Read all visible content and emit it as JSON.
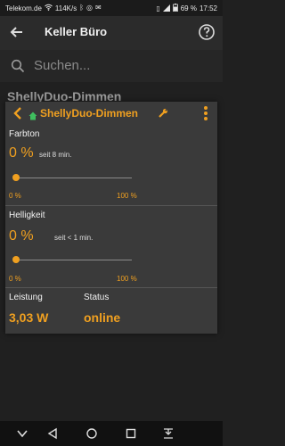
{
  "status": {
    "carrier": "Telekom.de",
    "speed": "114K/s",
    "battery": "69 %",
    "time": "17:52"
  },
  "header": {
    "title": "Keller Büro"
  },
  "search": {
    "placeholder": "Suchen..."
  },
  "background_list": {
    "first_item": "ShellyDuo-Dimmen"
  },
  "dialog": {
    "title": "ShellyDuo-Dimmen",
    "farbton": {
      "label": "Farbton",
      "value": "0 %",
      "since": "seit 8 min.",
      "min": "0 %",
      "max": "100 %",
      "level": 0
    },
    "helligkeit": {
      "label": "Helligkeit",
      "value": "0 %",
      "since": "seit < 1 min.",
      "min": "0 %",
      "max": "100 %",
      "level": 0
    },
    "leistung": {
      "label": "Leistung",
      "value": "3,03 W"
    },
    "status": {
      "label": "Status",
      "value": "online"
    }
  },
  "colors": {
    "accent": "#f0a020",
    "home_icon": "#3fbf5f",
    "background": "#202020",
    "dialog": "#3a3a3a"
  }
}
